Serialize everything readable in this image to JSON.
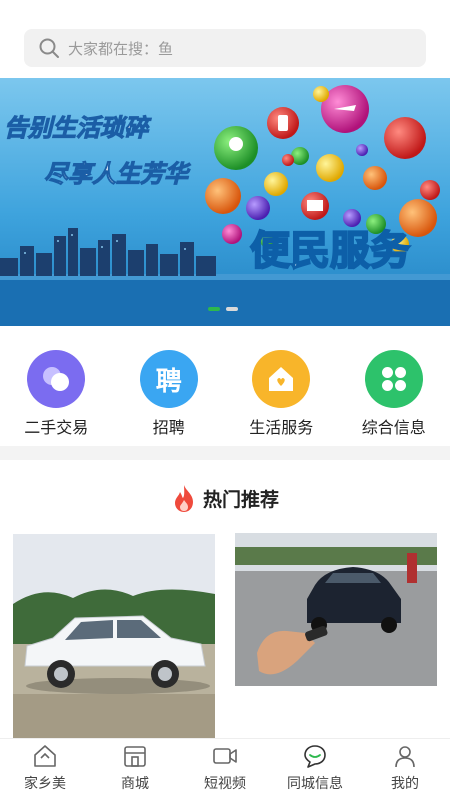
{
  "search": {
    "placeholder": "大家都在搜：鱼"
  },
  "banner": {
    "line1": "告别生活琐碎",
    "line2": "尽享人生芳华",
    "title": "便民服务"
  },
  "categories": [
    {
      "label": "二手交易",
      "icon": "two-circles-icon",
      "color": "#7b6cf0"
    },
    {
      "label": "招聘",
      "icon": "recruit-icon",
      "glyph": "聘",
      "color": "#3aa6f2"
    },
    {
      "label": "生活服务",
      "icon": "house-icon",
      "color": "#f8b52a"
    },
    {
      "label": "综合信息",
      "icon": "clover-icon",
      "color": "#2dc26b"
    }
  ],
  "section": {
    "title": "热门推荐"
  },
  "tabs": [
    {
      "label": "家乡美",
      "icon": "home-icon"
    },
    {
      "label": "商城",
      "icon": "shop-icon"
    },
    {
      "label": "短视频",
      "icon": "video-icon"
    },
    {
      "label": "同城信息",
      "icon": "chat-icon"
    },
    {
      "label": "我的",
      "icon": "profile-icon"
    }
  ],
  "colors": {
    "accent": "#2db84d",
    "fire": "#ef4a3c"
  }
}
